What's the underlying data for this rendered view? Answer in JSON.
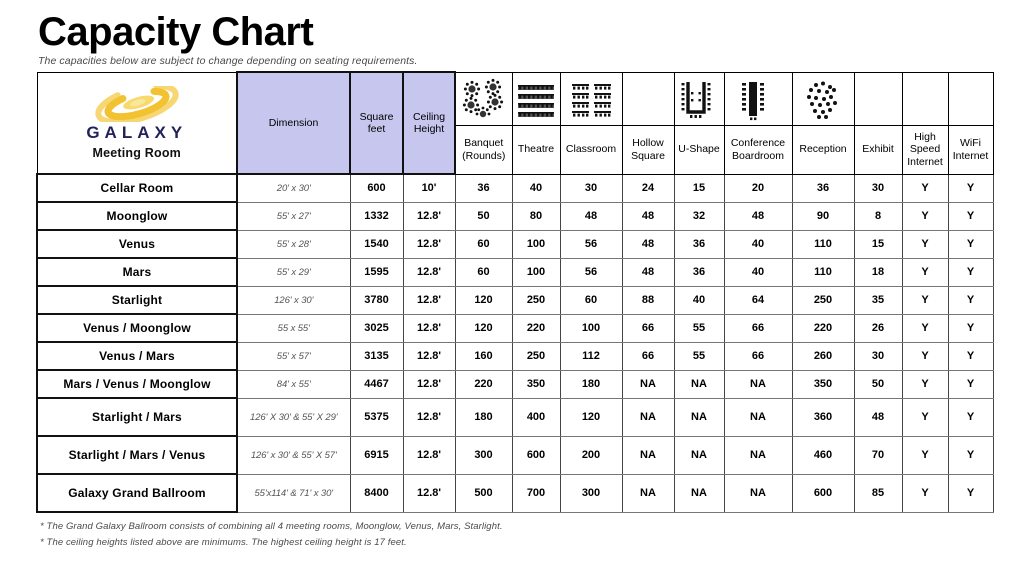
{
  "header": {
    "title": "Capacity Chart",
    "subtitle": "The capacities below are subject to change depending on seating requirements.",
    "brand": {
      "name": "GALAXY",
      "tagline": "Meeting Room",
      "logo_icon": "galaxy-spiral-icon",
      "logo_color": "#F5C63C",
      "wordmark_color": "#232259"
    },
    "accent_bg": "#C6C6EE"
  },
  "columns": [
    {
      "key": "room",
      "label": "",
      "icon": null
    },
    {
      "key": "dimension",
      "label": "Dimension",
      "icon": null
    },
    {
      "key": "sqft",
      "label": "Square\nfeet",
      "icon": null
    },
    {
      "key": "ceiling",
      "label": "Ceiling\nHeight",
      "icon": null
    },
    {
      "key": "banquet",
      "label": "Banquet\n(Rounds)",
      "icon": "banquet-rounds-icon"
    },
    {
      "key": "theatre",
      "label": "Theatre",
      "icon": "theatre-seating-icon"
    },
    {
      "key": "classroom",
      "label": "Classroom",
      "icon": "classroom-seating-icon"
    },
    {
      "key": "hollow",
      "label": "Hollow\nSquare",
      "icon": null
    },
    {
      "key": "ushape",
      "label": "U-Shape",
      "icon": "u-shape-icon"
    },
    {
      "key": "boardroom",
      "label": "Conference\nBoardroom",
      "icon": "boardroom-icon"
    },
    {
      "key": "reception",
      "label": "Reception",
      "icon": "reception-icon"
    },
    {
      "key": "exhibit",
      "label": "Exhibit",
      "icon": null
    },
    {
      "key": "hsi",
      "label": "High\nSpeed\nInternet",
      "icon": null
    },
    {
      "key": "wifi",
      "label": "WiFi\nInternet",
      "icon": null
    }
  ],
  "column_labels": {
    "dimension": "Dimension",
    "sqft_l1": "Square",
    "sqft_l2": "feet",
    "ceiling_l1": "Ceiling",
    "ceiling_l2": "Height",
    "banquet_l1": "Banquet",
    "banquet_l2": "(Rounds)",
    "theatre": "Theatre",
    "classroom": "Classroom",
    "hollow_l1": "Hollow",
    "hollow_l2": "Square",
    "ushape": "U-Shape",
    "boardroom_l1": "Conference",
    "boardroom_l2": "Boardroom",
    "reception": "Reception",
    "exhibit": "Exhibit",
    "hsi_l1": "High",
    "hsi_l2": "Speed",
    "hsi_l3": "Internet",
    "wifi_l1": "WiFi",
    "wifi_l2": "Internet"
  },
  "rows": [
    {
      "room": "Cellar Room",
      "dimension": "20' x 30'",
      "sqft": "600",
      "ceiling": "10'",
      "banquet": "36",
      "theatre": "40",
      "classroom": "30",
      "hollow": "24",
      "ushape": "15",
      "boardroom": "20",
      "reception": "36",
      "exhibit": "30",
      "hsi": "Y",
      "wifi": "Y"
    },
    {
      "room": "Moonglow",
      "dimension": "55' x 27'",
      "sqft": "1332",
      "ceiling": "12.8'",
      "banquet": "50",
      "theatre": "80",
      "classroom": "48",
      "hollow": "48",
      "ushape": "32",
      "boardroom": "48",
      "reception": "90",
      "exhibit": "8",
      "hsi": "Y",
      "wifi": "Y"
    },
    {
      "room": "Venus",
      "dimension": "55' x 28'",
      "sqft": "1540",
      "ceiling": "12.8'",
      "banquet": "60",
      "theatre": "100",
      "classroom": "56",
      "hollow": "48",
      "ushape": "36",
      "boardroom": "40",
      "reception": "110",
      "exhibit": "15",
      "hsi": "Y",
      "wifi": "Y"
    },
    {
      "room": "Mars",
      "dimension": "55' x 29'",
      "sqft": "1595",
      "ceiling": "12.8'",
      "banquet": "60",
      "theatre": "100",
      "classroom": "56",
      "hollow": "48",
      "ushape": "36",
      "boardroom": "40",
      "reception": "110",
      "exhibit": "18",
      "hsi": "Y",
      "wifi": "Y"
    },
    {
      "room": "Starlight",
      "dimension": "126' x 30'",
      "sqft": "3780",
      "ceiling": "12.8'",
      "banquet": "120",
      "theatre": "250",
      "classroom": "60",
      "hollow": "88",
      "ushape": "40",
      "boardroom": "64",
      "reception": "250",
      "exhibit": "35",
      "hsi": "Y",
      "wifi": "Y"
    },
    {
      "room": "Venus / Moonglow",
      "dimension": "55 x 55'",
      "sqft": "3025",
      "ceiling": "12.8'",
      "banquet": "120",
      "theatre": "220",
      "classroom": "100",
      "hollow": "66",
      "ushape": "55",
      "boardroom": "66",
      "reception": "220",
      "exhibit": "26",
      "hsi": "Y",
      "wifi": "Y"
    },
    {
      "room": "Venus / Mars",
      "dimension": "55' x 57'",
      "sqft": "3135",
      "ceiling": "12.8'",
      "banquet": "160",
      "theatre": "250",
      "classroom": "112",
      "hollow": "66",
      "ushape": "55",
      "boardroom": "66",
      "reception": "260",
      "exhibit": "30",
      "hsi": "Y",
      "wifi": "Y"
    },
    {
      "room": "Mars / Venus / Moonglow",
      "dimension": "84' x 55'",
      "sqft": "4467",
      "ceiling": "12.8'",
      "banquet": "220",
      "theatre": "350",
      "classroom": "180",
      "hollow": "NA",
      "ushape": "NA",
      "boardroom": "NA",
      "reception": "350",
      "exhibit": "50",
      "hsi": "Y",
      "wifi": "Y"
    },
    {
      "room": "Starlight / Mars",
      "dimension": "126' X 30'  &  55' X 29'",
      "sqft": "5375",
      "ceiling": "12.8'",
      "banquet": "180",
      "theatre": "400",
      "classroom": "120",
      "hollow": "NA",
      "ushape": "NA",
      "boardroom": "NA",
      "reception": "360",
      "exhibit": "48",
      "hsi": "Y",
      "wifi": "Y"
    },
    {
      "room": "Starlight / Mars / Venus",
      "dimension": "126' x 30'  &  55' X 57'",
      "sqft": "6915",
      "ceiling": "12.8'",
      "banquet": "300",
      "theatre": "600",
      "classroom": "200",
      "hollow": "NA",
      "ushape": "NA",
      "boardroom": "NA",
      "reception": "460",
      "exhibit": "70",
      "hsi": "Y",
      "wifi": "Y"
    },
    {
      "room": "Galaxy Grand Ballroom",
      "dimension": "55'x114'  &  71' x 30'",
      "sqft": "8400",
      "ceiling": "12.8'",
      "banquet": "500",
      "theatre": "700",
      "classroom": "300",
      "hollow": "NA",
      "ushape": "NA",
      "boardroom": "NA",
      "reception": "600",
      "exhibit": "85",
      "hsi": "Y",
      "wifi": "Y"
    }
  ],
  "footnotes": [
    "* The Grand Galaxy Ballroom consists of combining all 4 meeting rooms, Moonglow, Venus, Mars, Starlight.",
    "* The ceiling heights listed above are minimums.  The highest ceiling height is 17 feet."
  ]
}
